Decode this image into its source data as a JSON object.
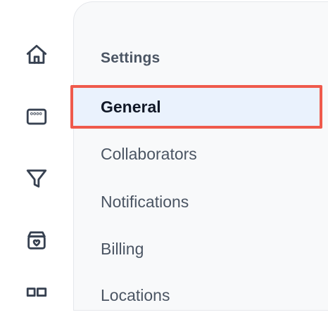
{
  "rail": {
    "items": [
      {
        "name": "home",
        "icon": "home-icon"
      },
      {
        "name": "window",
        "icon": "browser-window-icon"
      },
      {
        "name": "filter",
        "icon": "filter-icon"
      },
      {
        "name": "favorites",
        "icon": "box-heart-icon"
      },
      {
        "name": "more",
        "icon": "grid-icon"
      }
    ]
  },
  "settings": {
    "title": "Settings",
    "items": [
      {
        "label": "General",
        "active": true
      },
      {
        "label": "Collaborators",
        "active": false
      },
      {
        "label": "Notifications",
        "active": false
      },
      {
        "label": "Billing",
        "active": false
      },
      {
        "label": "Locations",
        "active": false
      }
    ]
  },
  "colors": {
    "active_bg": "#eaf2fd",
    "highlight_border": "#ef5a4c",
    "panel_bg": "#f8f9fa",
    "text": "#4b5563"
  }
}
